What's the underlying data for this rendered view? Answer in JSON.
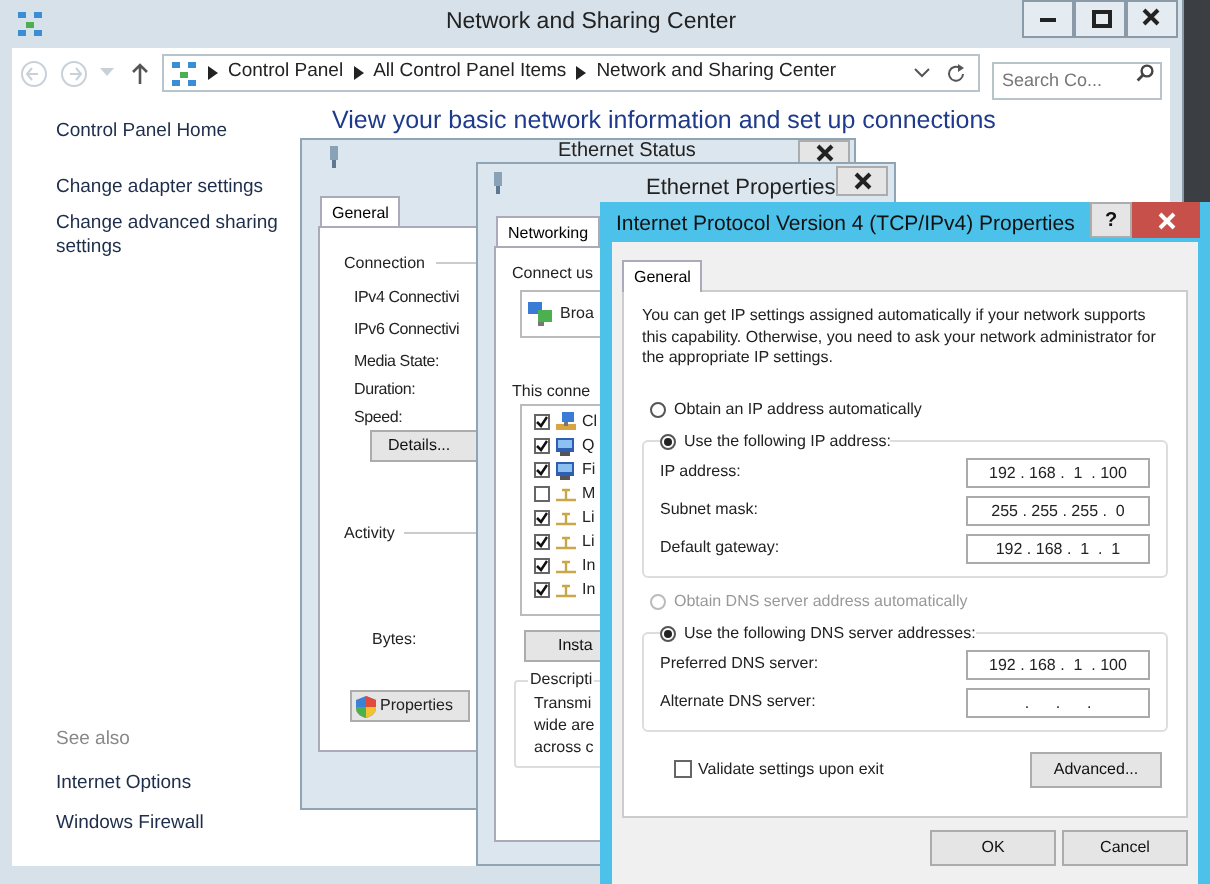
{
  "window": {
    "title": "Network and Sharing Center"
  },
  "address_bar": {
    "crumbs": [
      "Control Panel",
      "All Control Panel Items",
      "Network and Sharing Center"
    ]
  },
  "search": {
    "placeholder": "Search Co..."
  },
  "sidebar": {
    "links": [
      "Control Panel Home",
      "Change adapter settings",
      "Change advanced sharing settings"
    ],
    "see_also_label": "See also",
    "see_also_links": [
      "Internet Options",
      "Windows Firewall"
    ]
  },
  "heading": "View your basic network information and set up connections",
  "ethernet_status": {
    "title": "Ethernet Status",
    "tabs": [
      {
        "label": "General",
        "selected": true
      }
    ],
    "connection_label": "Connection",
    "fields": [
      "IPv4 Connectivi",
      "IPv6 Connectivi",
      "Media State:",
      "Duration:",
      "Speed:"
    ],
    "details_button": "Details...",
    "activity_label": "Activity",
    "bytes_label": "Bytes:",
    "properties_button": "Properties"
  },
  "ethernet_properties": {
    "title": "Ethernet Properties",
    "tabs": [
      {
        "label": "Networking",
        "selected": true
      }
    ],
    "connect_using_label": "Connect us",
    "adapter": "Broa",
    "items_label": "This conne",
    "items": [
      {
        "label": "Cl",
        "checked": true,
        "kind": "client"
      },
      {
        "label": "Q",
        "checked": true,
        "kind": "service"
      },
      {
        "label": "Fi",
        "checked": true,
        "kind": "service"
      },
      {
        "label": "M",
        "checked": false,
        "kind": "protocol"
      },
      {
        "label": "Li",
        "checked": true,
        "kind": "protocol"
      },
      {
        "label": "Li",
        "checked": true,
        "kind": "protocol"
      },
      {
        "label": "In",
        "checked": true,
        "kind": "protocol"
      },
      {
        "label": "In",
        "checked": true,
        "kind": "protocol"
      }
    ],
    "install_button": "Insta",
    "description_label": "Descripti",
    "description": [
      "Transmi",
      "wide are",
      "across c"
    ]
  },
  "ipv4_properties": {
    "title": "Internet Protocol Version 4 (TCP/IPv4) Properties",
    "help_button": "?",
    "tabs": [
      {
        "label": "General",
        "selected": true
      }
    ],
    "intro": "You can get IP settings assigned automatically if your network supports this capability. Otherwise, you need to ask your network administrator for the appropriate IP settings.",
    "ip_options": [
      {
        "label": "Obtain an IP address automatically",
        "selected": false,
        "disabled": false
      },
      {
        "label": "Use the following IP address:",
        "selected": true,
        "disabled": false
      }
    ],
    "ip_fields": [
      {
        "label": "IP address:",
        "value": "192 . 168 .  1  . 100"
      },
      {
        "label": "Subnet mask:",
        "value": "255 . 255 . 255 .  0"
      },
      {
        "label": "Default gateway:",
        "value": "192 . 168 .  1  .  1"
      }
    ],
    "dns_options": [
      {
        "label": "Obtain DNS server address automatically",
        "selected": false,
        "disabled": true
      },
      {
        "label": "Use the following DNS server addresses:",
        "selected": true,
        "disabled": false
      }
    ],
    "dns_fields": [
      {
        "label": "Preferred DNS server:",
        "value": "192 . 168 .  1  . 100"
      },
      {
        "label": "Alternate DNS server:",
        "value": ".      .      ."
      }
    ],
    "validate": {
      "label": "Validate settings upon exit",
      "checked": false
    },
    "advanced_button": "Advanced...",
    "buttons": [
      "OK",
      "Cancel"
    ]
  }
}
